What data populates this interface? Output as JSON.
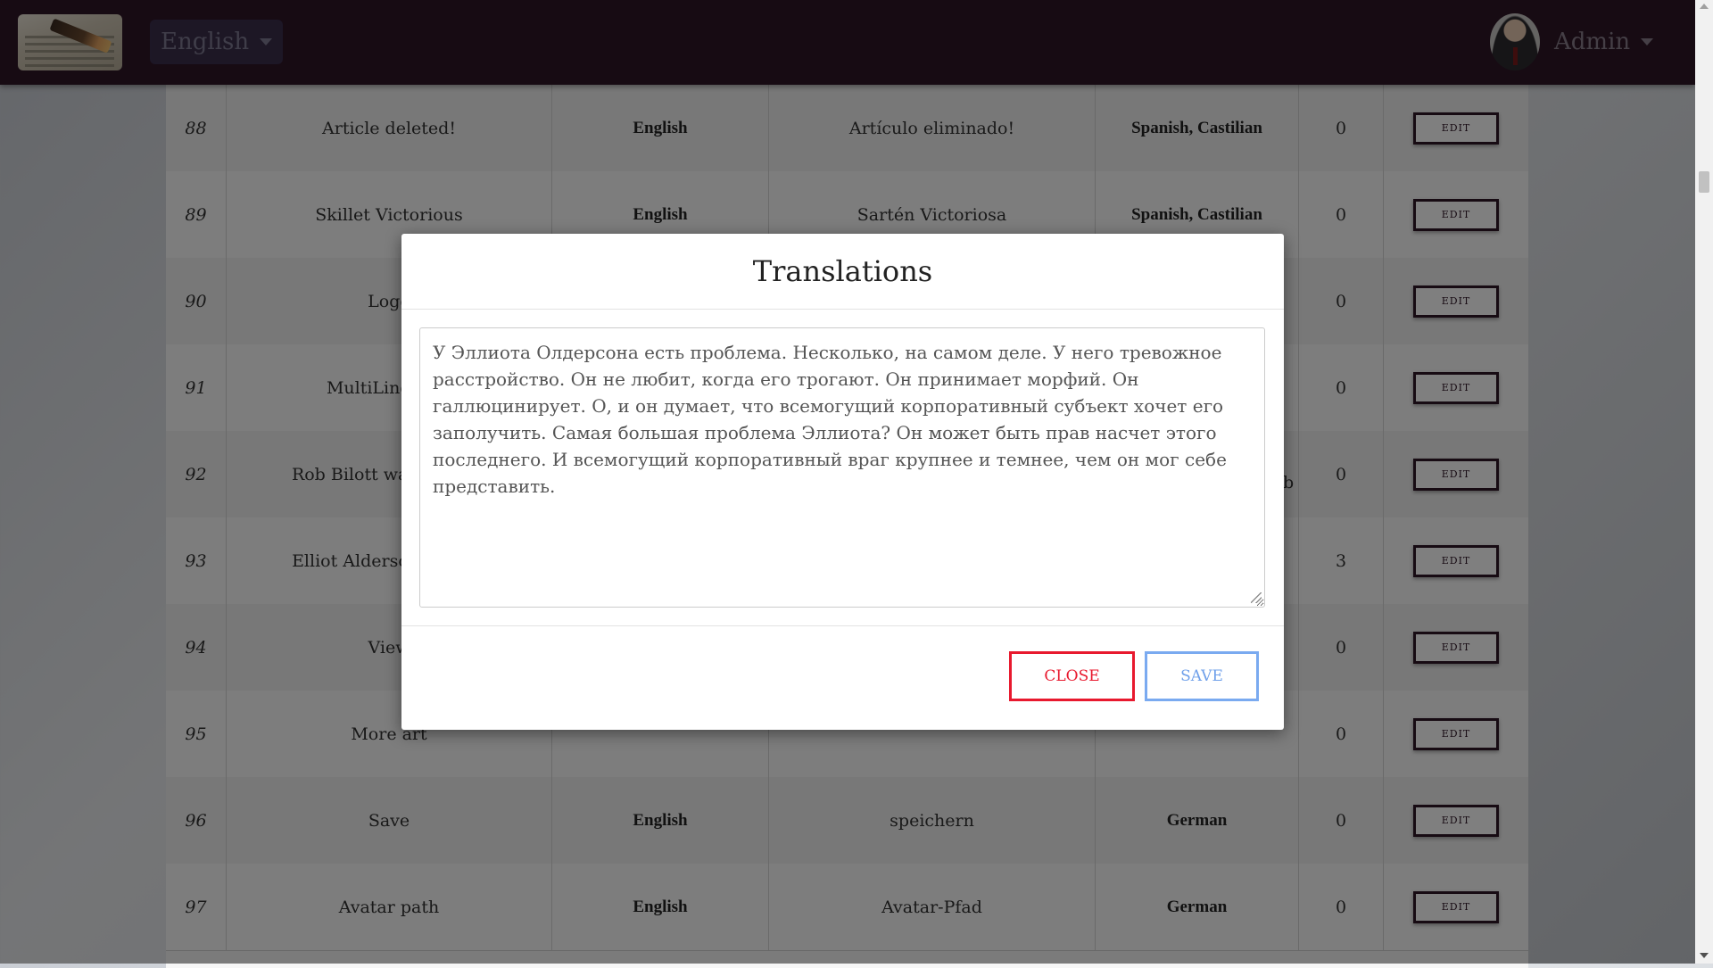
{
  "navbar": {
    "language": "English",
    "user": "Admin"
  },
  "table": {
    "rows": [
      {
        "id": "88",
        "text": "Article deleted!",
        "lang": "English",
        "translation": "Artículo eliminado!",
        "target_lang": "Spanish, Castilian",
        "count": "0",
        "edit": "EDIT"
      },
      {
        "id": "89",
        "text": "Skillet Victorious",
        "lang": "English",
        "translation": "Sartén Victoriosa",
        "target_lang": "Spanish, Castilian",
        "count": "0",
        "edit": "EDIT"
      },
      {
        "id": "90",
        "text": "Logo",
        "lang": "",
        "translation": "",
        "target_lang": "",
        "count": "0",
        "edit": "EDIT"
      },
      {
        "id": "91",
        "text": "MultiLingo art",
        "lang": "",
        "translation": "",
        "target_lang": "",
        "count": "0",
        "edit": "EDIT"
      },
      {
        "id": "92",
        "text": "Rob Bilott was never a",
        "lang": "",
        "translation": "",
        "target_lang": "",
        "count": "0",
        "edit": "EDIT"
      },
      {
        "id": "93",
        "text": "Elliot Alderson has a p",
        "lang": "",
        "translation": "",
        "target_lang": "",
        "count": "3",
        "edit": "EDIT"
      },
      {
        "id": "94",
        "text": "View",
        "lang": "",
        "translation": "",
        "target_lang": "",
        "count": "0",
        "edit": "EDIT"
      },
      {
        "id": "95",
        "text": "More art",
        "lang": "",
        "translation": "",
        "target_lang": "",
        "count": "0",
        "edit": "EDIT"
      },
      {
        "id": "96",
        "text": "Save",
        "lang": "English",
        "translation": "speichern",
        "target_lang": "German",
        "count": "0",
        "edit": "EDIT"
      },
      {
        "id": "97",
        "text": "Avatar path",
        "lang": "English",
        "translation": "Avatar-Pfad",
        "target_lang": "German",
        "count": "0",
        "edit": "EDIT"
      }
    ],
    "stray_fragment": "b"
  },
  "modal": {
    "title": "Translations",
    "textarea_value": "У Эллиота Олдерсона есть проблема. Несколько, на самом деле. У него тревожное расстройство. Он не любит, когда его трогают. Он принимает морфий. Он галлюцинирует. О, и он думает, что всемогущий корпоративный субъект хочет его заполучить. Самая большая проблема Эллиота? Он может быть прав насчет этого последнего. И всемогущий корпоративный враг крупнее и темнее, чем он мог себе представить.",
    "close_label": "CLOSE",
    "save_label": "SAVE"
  },
  "colors": {
    "navbar": "#2e1727",
    "close": "#e8192e",
    "save": "#7aaaf0"
  }
}
